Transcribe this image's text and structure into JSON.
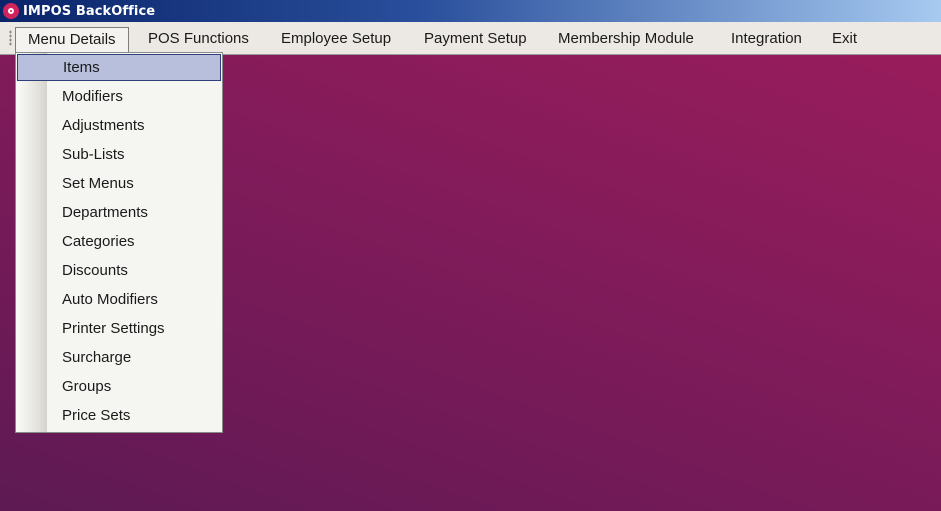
{
  "window": {
    "title": "IMPOS BackOffice",
    "icon": "app-logo-icon"
  },
  "menubar": {
    "items": [
      {
        "label": "Menu Details",
        "open": true
      },
      {
        "label": "POS Functions"
      },
      {
        "label": "Employee Setup"
      },
      {
        "label": "Payment Setup"
      },
      {
        "label": "Membership Module"
      },
      {
        "label": "Integration"
      },
      {
        "label": "Exit"
      }
    ]
  },
  "dropdown": {
    "selected_index": 0,
    "items": [
      "Items",
      "Modifiers",
      "Adjustments",
      "Sub-Lists",
      "Set Menus",
      "Departments",
      "Categories",
      "Discounts",
      "Auto Modifiers",
      "Printer Settings",
      "Surcharge",
      "Groups",
      "Price Sets"
    ]
  },
  "colors": {
    "accent_selection": "#b8bfdc",
    "desktop": "#7a1c5a",
    "titlebar": "#0a246a"
  }
}
